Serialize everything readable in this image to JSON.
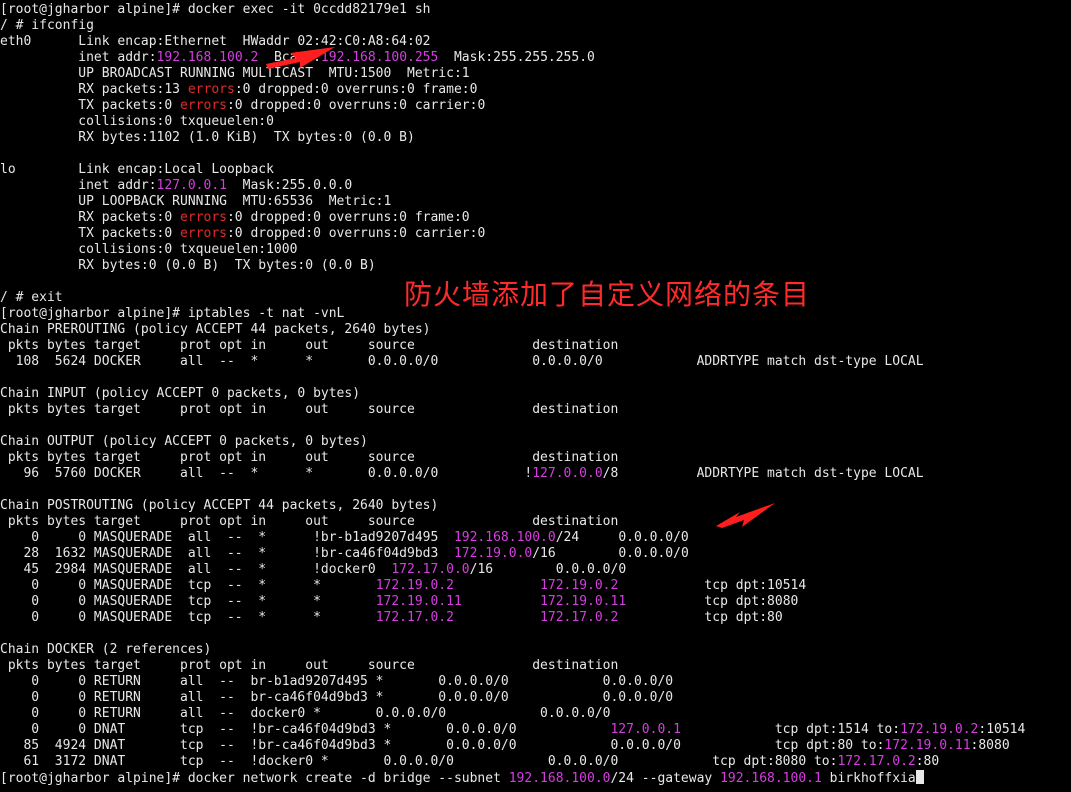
{
  "terminal": {
    "lines": [
      [
        {
          "t": "[root@jgharbor alpine]# docker exec -it 0ccdd82179e1 sh"
        }
      ],
      [
        {
          "t": "/ # ifconfig"
        }
      ],
      [
        {
          "t": "eth0      Link encap:Ethernet  HWaddr 02:42:C0:A8:64:02"
        }
      ],
      [
        {
          "t": "          inet addr:"
        },
        {
          "t": "192.168.100.2",
          "c": "hl"
        },
        {
          "t": "  Bcast:"
        },
        {
          "t": "192.168.100.255",
          "c": "hl"
        },
        {
          "t": "  Mask:255.255.255.0"
        }
      ],
      [
        {
          "t": "          UP BROADCAST RUNNING MULTICAST  MTU:1500  Metric:1"
        }
      ],
      [
        {
          "t": "          RX packets:13 "
        },
        {
          "t": "errors",
          "c": "rd"
        },
        {
          "t": ":0 dropped:0 overruns:0 frame:0"
        }
      ],
      [
        {
          "t": "          TX packets:0 "
        },
        {
          "t": "errors",
          "c": "rd"
        },
        {
          "t": ":0 dropped:0 overruns:0 carrier:0"
        }
      ],
      [
        {
          "t": "          collisions:0 txqueuelen:0"
        }
      ],
      [
        {
          "t": "          RX bytes:1102 (1.0 KiB)  TX bytes:0 (0.0 B)"
        }
      ],
      [
        {
          "t": ""
        }
      ],
      [
        {
          "t": "lo        Link encap:Local Loopback"
        }
      ],
      [
        {
          "t": "          inet addr:"
        },
        {
          "t": "127.0.0.1",
          "c": "hl"
        },
        {
          "t": "  Mask:255.0.0.0"
        }
      ],
      [
        {
          "t": "          UP LOOPBACK RUNNING  MTU:65536  Metric:1"
        }
      ],
      [
        {
          "t": "          RX packets:0 "
        },
        {
          "t": "errors",
          "c": "rd"
        },
        {
          "t": ":0 dropped:0 overruns:0 frame:0"
        }
      ],
      [
        {
          "t": "          TX packets:0 "
        },
        {
          "t": "errors",
          "c": "rd"
        },
        {
          "t": ":0 dropped:0 overruns:0 carrier:0"
        }
      ],
      [
        {
          "t": "          collisions:0 txqueuelen:1000"
        }
      ],
      [
        {
          "t": "          RX bytes:0 (0.0 B)  TX bytes:0 (0.0 B)"
        }
      ],
      [
        {
          "t": ""
        }
      ],
      [
        {
          "t": "/ # exit"
        }
      ],
      [
        {
          "t": "[root@jgharbor alpine]# iptables -t nat -vnL"
        }
      ],
      [
        {
          "t": "Chain PREROUTING (policy ACCEPT 44 packets, 2640 bytes)"
        }
      ],
      [
        {
          "t": " pkts bytes target     prot opt in     out     source               destination"
        }
      ],
      [
        {
          "t": "  108  5624 DOCKER     all  --  *      *       0.0.0.0/0            0.0.0.0/0            ADDRTYPE match dst-type LOCAL"
        }
      ],
      [
        {
          "t": ""
        }
      ],
      [
        {
          "t": "Chain INPUT (policy ACCEPT 0 packets, 0 bytes)"
        }
      ],
      [
        {
          "t": " pkts bytes target     prot opt in     out     source               destination"
        }
      ],
      [
        {
          "t": ""
        }
      ],
      [
        {
          "t": "Chain OUTPUT (policy ACCEPT 0 packets, 0 bytes)"
        }
      ],
      [
        {
          "t": " pkts bytes target     prot opt in     out     source               destination"
        }
      ],
      [
        {
          "t": "   96  5760 DOCKER     all  --  *      *       0.0.0.0/0           !"
        },
        {
          "t": "127.0.0.0",
          "c": "hl"
        },
        {
          "t": "/8          ADDRTYPE match dst-type LOCAL"
        }
      ],
      [
        {
          "t": ""
        }
      ],
      [
        {
          "t": "Chain POSTROUTING (policy ACCEPT 44 packets, 2640 bytes)"
        }
      ],
      [
        {
          "t": " pkts bytes target     prot opt in     out     source               destination"
        }
      ],
      [
        {
          "t": "    0     0 MASQUERADE  all  --  *      !br-b1ad9207d495  "
        },
        {
          "t": "192.168.100.0",
          "c": "hl"
        },
        {
          "t": "/24     0.0.0.0/0"
        }
      ],
      [
        {
          "t": "   28  1632 MASQUERADE  all  --  *      !br-ca46f04d9bd3  "
        },
        {
          "t": "172.19.0.0",
          "c": "hl"
        },
        {
          "t": "/16        0.0.0.0/0"
        }
      ],
      [
        {
          "t": "   45  2984 MASQUERADE  all  --  *      !docker0  "
        },
        {
          "t": "172.17.0.0",
          "c": "hl"
        },
        {
          "t": "/16        0.0.0.0/0"
        }
      ],
      [
        {
          "t": "    0     0 MASQUERADE  tcp  --  *      *       "
        },
        {
          "t": "172.19.0.2",
          "c": "hl"
        },
        {
          "t": "           "
        },
        {
          "t": "172.19.0.2",
          "c": "hl"
        },
        {
          "t": "           tcp dpt:10514"
        }
      ],
      [
        {
          "t": "    0     0 MASQUERADE  tcp  --  *      *       "
        },
        {
          "t": "172.19.0.11",
          "c": "hl"
        },
        {
          "t": "          "
        },
        {
          "t": "172.19.0.11",
          "c": "hl"
        },
        {
          "t": "          tcp dpt:8080"
        }
      ],
      [
        {
          "t": "    0     0 MASQUERADE  tcp  --  *      *       "
        },
        {
          "t": "172.17.0.2",
          "c": "hl"
        },
        {
          "t": "           "
        },
        {
          "t": "172.17.0.2",
          "c": "hl"
        },
        {
          "t": "           tcp dpt:80"
        }
      ],
      [
        {
          "t": ""
        }
      ],
      [
        {
          "t": "Chain DOCKER (2 references)"
        }
      ],
      [
        {
          "t": " pkts bytes target     prot opt in     out     source               destination"
        }
      ],
      [
        {
          "t": "    0     0 RETURN     all  --  br-b1ad9207d495 *       0.0.0.0/0            0.0.0.0/0"
        }
      ],
      [
        {
          "t": "    0     0 RETURN     all  --  br-ca46f04d9bd3 *       0.0.0.0/0            0.0.0.0/0"
        }
      ],
      [
        {
          "t": "    0     0 RETURN     all  --  docker0 *       0.0.0.0/0            0.0.0.0/0"
        }
      ],
      [
        {
          "t": "    0     0 DNAT       tcp  --  !br-ca46f04d9bd3 *       0.0.0.0/0            "
        },
        {
          "t": "127.0.0.1",
          "c": "hl"
        },
        {
          "t": "            tcp dpt:1514 to:"
        },
        {
          "t": "172.19.0.2",
          "c": "hl"
        },
        {
          "t": ":10514"
        }
      ],
      [
        {
          "t": "   85  4924 DNAT       tcp  --  !br-ca46f04d9bd3 *       0.0.0.0/0            0.0.0.0/0            tcp dpt:80 to:"
        },
        {
          "t": "172.19.0.11",
          "c": "hl"
        },
        {
          "t": ":8080"
        }
      ],
      [
        {
          "t": "   61  3172 DNAT       tcp  --  !docker0 *       0.0.0.0/0            0.0.0.0/0            tcp dpt:8080 to:"
        },
        {
          "t": "172.17.0.2",
          "c": "hl"
        },
        {
          "t": ":80"
        }
      ],
      [
        {
          "t": "[root@jgharbor alpine]# docker network create -d bridge --subnet "
        },
        {
          "t": "192.168.100.0",
          "c": "hl"
        },
        {
          "t": "/24 --gateway "
        },
        {
          "t": "192.168.100.1",
          "c": "hl"
        },
        {
          "t": " birkhoffxia"
        }
      ]
    ]
  },
  "annotation": {
    "text": "防火墙添加了自定义网络的条目",
    "color": "#ff2a2a"
  },
  "colors": {
    "background": "#000000",
    "text": "#e8e8e8",
    "ip_highlight": "#d63ee0",
    "error_highlight": "#e22a2a",
    "arrow": "#ff1e1e"
  }
}
